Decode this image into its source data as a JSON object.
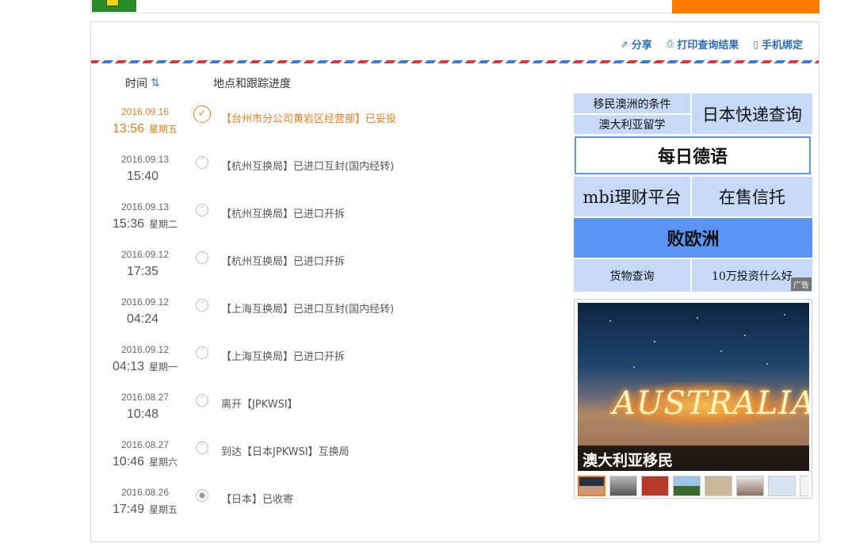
{
  "header": {
    "actions": [
      {
        "icon": "share-icon",
        "label": "分享"
      },
      {
        "icon": "print-icon",
        "label": "打印查询结果"
      },
      {
        "icon": "phone-icon",
        "label": "手机绑定"
      }
    ]
  },
  "table": {
    "time_header": "时间",
    "sort_icon": "sort-arrows-icon",
    "place_header": "地点和跟踪进度"
  },
  "events": [
    {
      "date": "2016.09.16",
      "time": "13:56",
      "weekday": "星期五",
      "desc": "【台州市分公司黄岩区经营部】已妥投",
      "status": "delivered"
    },
    {
      "date": "2016.09.13",
      "time": "15:40",
      "weekday": "",
      "desc": "【杭州互换局】已进口互封(国内经转)",
      "status": "transit"
    },
    {
      "date": "2016.09.13",
      "time": "15:36",
      "weekday": "星期二",
      "desc": "【杭州互换局】已进口开拆",
      "status": "transit"
    },
    {
      "date": "2016.09.12",
      "time": "17:35",
      "weekday": "",
      "desc": "【杭州互换局】已进口开拆",
      "status": "transit"
    },
    {
      "date": "2016.09.12",
      "time": "04:24",
      "weekday": "",
      "desc": "【上海互换局】已进口互封(国内经转)",
      "status": "transit"
    },
    {
      "date": "2016.09.12",
      "time": "04:13",
      "weekday": "星期一",
      "desc": "【上海互换局】已进口开拆",
      "status": "transit"
    },
    {
      "date": "2016.08.27",
      "time": "10:48",
      "weekday": "",
      "desc": "离开【JPKWSI】",
      "status": "transit"
    },
    {
      "date": "2016.08.27",
      "time": "10:46",
      "weekday": "星期六",
      "desc": "到达【日本JPKWSI】互换局",
      "status": "transit"
    },
    {
      "date": "2016.08.26",
      "time": "17:49",
      "weekday": "星期五",
      "desc": "【日本】已收寄",
      "status": "origin"
    }
  ],
  "ad_links": {
    "a1": "移民澳洲的条件",
    "a2": "澳大利亚留学",
    "a3": "日本快递查询",
    "a4": "每日德语",
    "a5": "mbi理财平台",
    "a6": "在售信托",
    "a7": "败欧洲",
    "a8": "货物查询",
    "a9": "10万投资什么好",
    "ad_label": "广告"
  },
  "image_ad": {
    "caption": "澳大利亚移民",
    "lights_text": "AUSTRALIA",
    "thumb_count": 8
  },
  "colors": {
    "accent_orange": "#f07c1e",
    "link_blue": "#2c6fb5",
    "ad_cell": "#c6d9f7",
    "ad_cell_strong": "#5a95f5"
  }
}
